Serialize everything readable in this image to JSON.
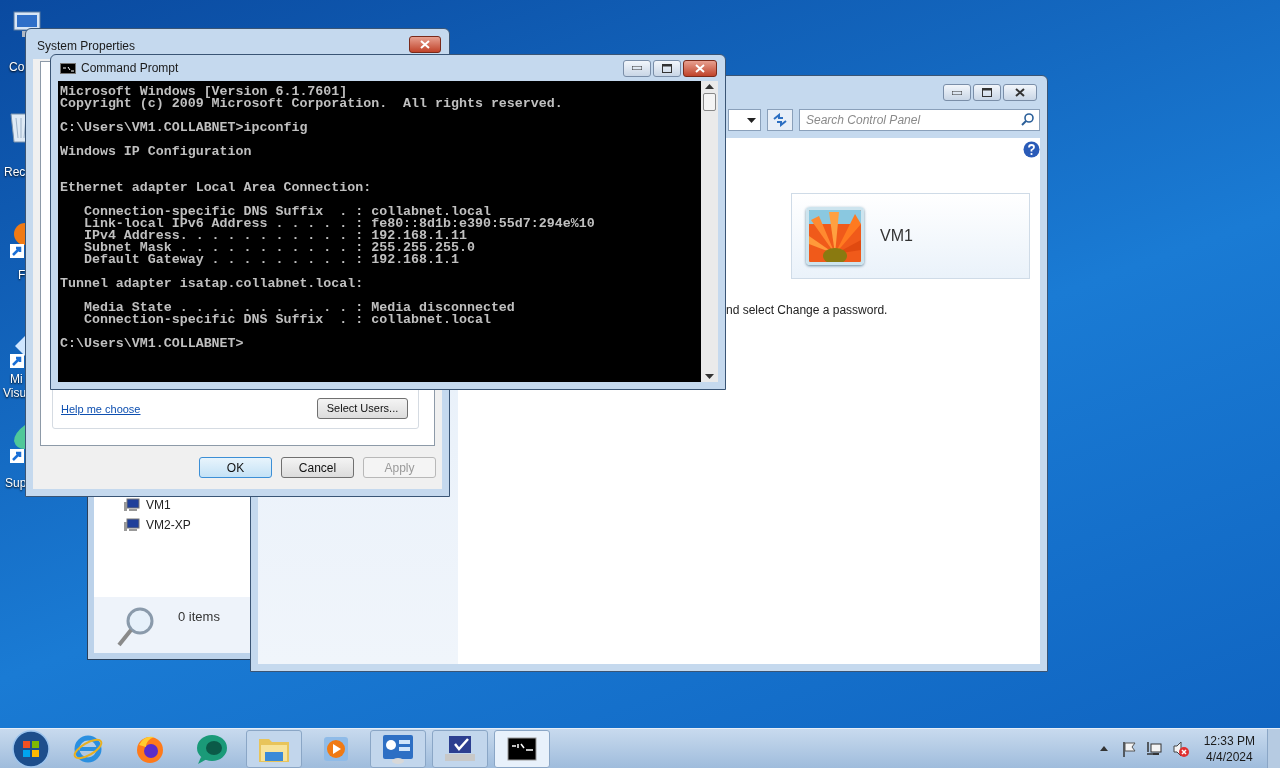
{
  "desktop_icons": [
    {
      "label": "Co",
      "kind": "computer"
    },
    {
      "label": "Rec",
      "kind": "bin"
    },
    {
      "label": "F",
      "kind": "shortcut"
    },
    {
      "label": "Mi",
      "kind": "studio"
    },
    {
      "label": "Visu",
      "kind": "none"
    },
    {
      "label": "Sup",
      "kind": "support"
    }
  ],
  "explorer": {
    "tree_items": [
      "VM1",
      "VM2-XP"
    ],
    "status": "0 items"
  },
  "control_panel": {
    "search": {
      "placeholder": "Search Control Panel"
    },
    "user_name": "VM1",
    "hint": "nd select Change a password."
  },
  "system_properties": {
    "title": "System Properties",
    "link": "Help me choose",
    "select_users": "Select Users...",
    "buttons": [
      {
        "label": "OK",
        "default": true,
        "disabled": false
      },
      {
        "label": "Cancel",
        "default": false,
        "disabled": false
      },
      {
        "label": "Apply",
        "default": false,
        "disabled": true
      }
    ]
  },
  "command_prompt": {
    "title": "Command Prompt",
    "output": "Microsoft Windows [Version 6.1.7601]\nCopyright (c) 2009 Microsoft Corporation.  All rights reserved.\n\nC:\\Users\\VM1.COLLABNET>ipconfig\n\nWindows IP Configuration\n\n\nEthernet adapter Local Area Connection:\n\n   Connection-specific DNS Suffix  . : collabnet.local\n   Link-local IPv6 Address . . . . . : fe80::8d1b:e390:55d7:294e%10\n   IPv4 Address. . . . . . . . . . . : 192.168.1.11\n   Subnet Mask . . . . . . . . . . . : 255.255.255.0\n   Default Gateway . . . . . . . . . : 192.168.1.1\n\nTunnel adapter isatap.collabnet.local:\n\n   Media State . . . . . . . . . . . : Media disconnected\n   Connection-specific DNS Suffix  . : collabnet.local\n\nC:\\Users\\VM1.COLLABNET>"
  },
  "taskbar": {
    "items": [
      {
        "kind": "start",
        "open": false,
        "selected": false
      },
      {
        "kind": "browser",
        "open": false,
        "selected": false
      },
      {
        "kind": "firefox",
        "open": false,
        "selected": false
      },
      {
        "kind": "chat",
        "open": false,
        "selected": false
      },
      {
        "kind": "folder",
        "open": true,
        "selected": false
      },
      {
        "kind": "media",
        "open": false,
        "selected": false
      },
      {
        "kind": "panel",
        "open": true,
        "selected": false
      },
      {
        "kind": "network",
        "open": true,
        "selected": false
      },
      {
        "kind": "console",
        "open": true,
        "selected": true
      }
    ],
    "time": "12:33 PM",
    "date": "4/4/2024"
  }
}
